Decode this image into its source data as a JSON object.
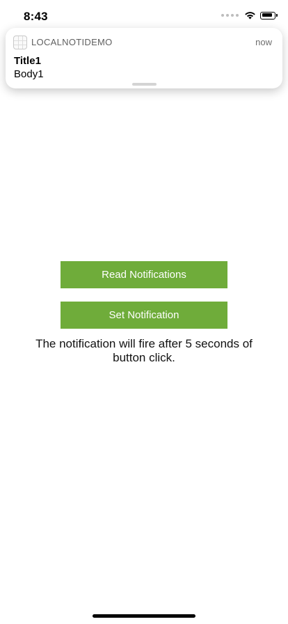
{
  "status_bar": {
    "time": "8:43",
    "icons": [
      "cellular-signal-icon",
      "wifi-icon",
      "battery-icon"
    ]
  },
  "notification": {
    "app_name": "LOCALNOTIDEMO",
    "time": "now",
    "title": "Title1",
    "body": "Body1"
  },
  "main": {
    "read_button_label": "Read Notifications",
    "set_button_label": "Set Notification",
    "info_text": "The notification will fire after 5 seconds of button click."
  },
  "colors": {
    "button_bg": "#6fac3a",
    "button_text": "#ffffff"
  }
}
